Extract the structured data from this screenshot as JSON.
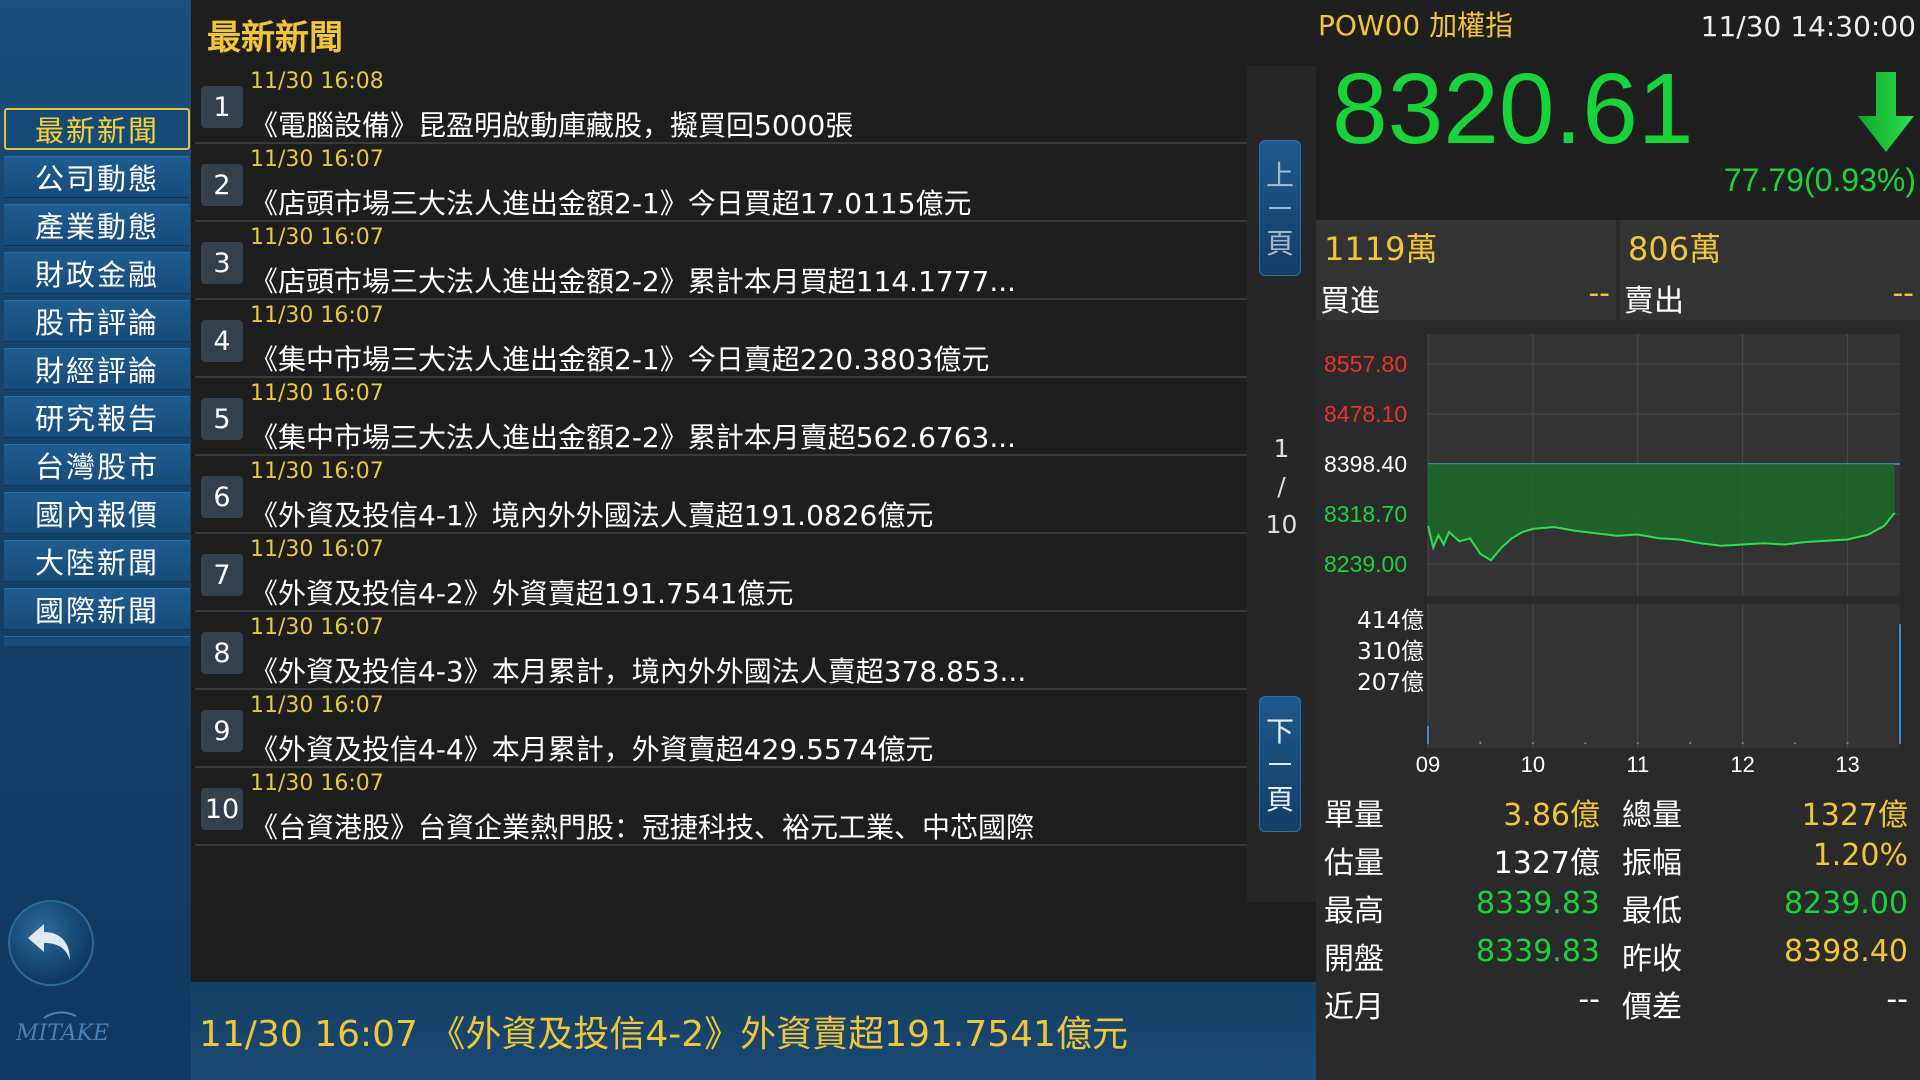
{
  "sidebar": {
    "items": [
      {
        "label": "最新新聞"
      },
      {
        "label": "公司動態"
      },
      {
        "label": "產業動態"
      },
      {
        "label": "財政金融"
      },
      {
        "label": "股市評論"
      },
      {
        "label": "財經評論"
      },
      {
        "label": "研究報告"
      },
      {
        "label": "台灣股市"
      },
      {
        "label": "國內報價"
      },
      {
        "label": "大陸新聞"
      },
      {
        "label": "國際新聞"
      }
    ],
    "active_index": 0,
    "back_icon": "back-arrow-icon",
    "logo_text": "MITAKE"
  },
  "news": {
    "title": "最新新聞",
    "rows": [
      {
        "num": "1",
        "time": "11/30 16:08",
        "text": "《電腦設備》昆盈明啟動庫藏股，擬買回5000張"
      },
      {
        "num": "2",
        "time": "11/30 16:07",
        "text": "《店頭市場三大法人進出金額2-1》今日買超17.0115億元"
      },
      {
        "num": "3",
        "time": "11/30 16:07",
        "text": "《店頭市場三大法人進出金額2-2》累計本月買超114.1777..."
      },
      {
        "num": "4",
        "time": "11/30 16:07",
        "text": "《集中市場三大法人進出金額2-1》今日賣超220.3803億元"
      },
      {
        "num": "5",
        "time": "11/30 16:07",
        "text": "《集中市場三大法人進出金額2-2》累計本月賣超562.6763..."
      },
      {
        "num": "6",
        "time": "11/30 16:07",
        "text": "《外資及投信4-1》境內外外國法人賣超191.0826億元"
      },
      {
        "num": "7",
        "time": "11/30 16:07",
        "text": "《外資及投信4-2》外資賣超191.7541億元"
      },
      {
        "num": "8",
        "time": "11/30 16:07",
        "text": "《外資及投信4-3》本月累計，境內外外國法人賣超378.853..."
      },
      {
        "num": "9",
        "time": "11/30 16:07",
        "text": "《外資及投信4-4》本月累計，外資賣超429.5574億元"
      },
      {
        "num": "10",
        "time": "11/30 16:07",
        "text": "《台資港股》台資企業熱門股：冠捷科技、裕元工業、中芯國際"
      }
    ],
    "pager": {
      "prev": [
        "上",
        "頁"
      ],
      "next": [
        "下",
        "頁"
      ],
      "current": "1",
      "sep": "/",
      "total": "10"
    },
    "ticker": "11/30 16:07 《外資及投信4-2》外資賣超191.7541億元"
  },
  "quote": {
    "symbol": "POW00 加權指",
    "time": "11/30 14:30:00",
    "price": "8320.61",
    "change": "77.79(0.93%)",
    "direction_icon": "down-arrow-icon",
    "bid_volume": "1119萬",
    "ask_volume": "806萬",
    "bid_label": "買進",
    "ask_label": "賣出",
    "bid_value": "--",
    "ask_value": "--",
    "colors": {
      "up": "#e8332b",
      "down": "#19d33a",
      "neutral": "#ffffff",
      "accent": "#f0c53a"
    },
    "stats": [
      {
        "l1": "單量",
        "v1": "3.86億",
        "c1": "#f0c53a",
        "l2": "總量",
        "v2": "1327億",
        "c2": "#f0c53a"
      },
      {
        "l1": "估量",
        "v1": "1327億",
        "c1": "#ffffff",
        "l2": "振幅",
        "v2": "1.20%",
        "c2": "#f0c53a"
      },
      {
        "l1": "最高",
        "v1": "8339.83",
        "c1": "#19d33a",
        "l2": "最低",
        "v2": "8239.00",
        "c2": "#19d33a"
      },
      {
        "l1": "開盤",
        "v1": "8339.83",
        "c1": "#19d33a",
        "l2": "昨收",
        "v2": "8398.40",
        "c2": "#f0c53a"
      },
      {
        "l1": "近月",
        "v1": "--",
        "c1": "#ffffff",
        "l2": "價差",
        "v2": "--",
        "c2": "#ffffff"
      }
    ]
  },
  "chart_data": {
    "type": "line",
    "price_ticks": [
      {
        "label": "8557.80",
        "value": 8557.8,
        "color": "#e8332b"
      },
      {
        "label": "8478.10",
        "value": 8478.1,
        "color": "#e8332b"
      },
      {
        "label": "8398.40",
        "value": 8398.4,
        "color": "#ffffff"
      },
      {
        "label": "8318.70",
        "value": 8318.7,
        "color": "#19d33a"
      },
      {
        "label": "8239.00",
        "value": 8239.0,
        "color": "#19d33a"
      }
    ],
    "reference": 8398.4,
    "ylim": [
      8239.0,
      8557.8
    ],
    "x_ticks": [
      "09",
      "10",
      "11",
      "12",
      "13"
    ],
    "x_range": [
      9.0,
      13.5
    ],
    "series": [
      {
        "values": [
          [
            9.0,
            8300
          ],
          [
            9.05,
            8265
          ],
          [
            9.1,
            8285
          ],
          [
            9.15,
            8270
          ],
          [
            9.2,
            8290
          ],
          [
            9.3,
            8275
          ],
          [
            9.4,
            8280
          ],
          [
            9.5,
            8255
          ],
          [
            9.6,
            8245
          ],
          [
            9.7,
            8265
          ],
          [
            9.8,
            8280
          ],
          [
            9.9,
            8290
          ],
          [
            10.0,
            8295
          ],
          [
            10.2,
            8298
          ],
          [
            10.4,
            8292
          ],
          [
            10.6,
            8288
          ],
          [
            10.8,
            8284
          ],
          [
            11.0,
            8286
          ],
          [
            11.2,
            8280
          ],
          [
            11.4,
            8278
          ],
          [
            11.6,
            8272
          ],
          [
            11.8,
            8268
          ],
          [
            12.0,
            8270
          ],
          [
            12.2,
            8272
          ],
          [
            12.4,
            8270
          ],
          [
            12.6,
            8274
          ],
          [
            12.8,
            8276
          ],
          [
            13.0,
            8278
          ],
          [
            13.2,
            8286
          ],
          [
            13.35,
            8300
          ],
          [
            13.45,
            8320.61
          ]
        ]
      }
    ],
    "volume_ticks": [
      {
        "label": "414億",
        "value": 414
      },
      {
        "label": "310億",
        "value": 310
      },
      {
        "label": "207億",
        "value": 207
      }
    ],
    "volume_ylim": [
      0,
      414
    ],
    "volume": [
      [
        9.0,
        60
      ],
      [
        9.5,
        8
      ],
      [
        10.0,
        6
      ],
      [
        10.5,
        5
      ],
      [
        11.0,
        5
      ],
      [
        11.5,
        7
      ],
      [
        12.0,
        6
      ],
      [
        12.5,
        5
      ],
      [
        13.0,
        6
      ],
      [
        13.5,
        400
      ]
    ]
  }
}
